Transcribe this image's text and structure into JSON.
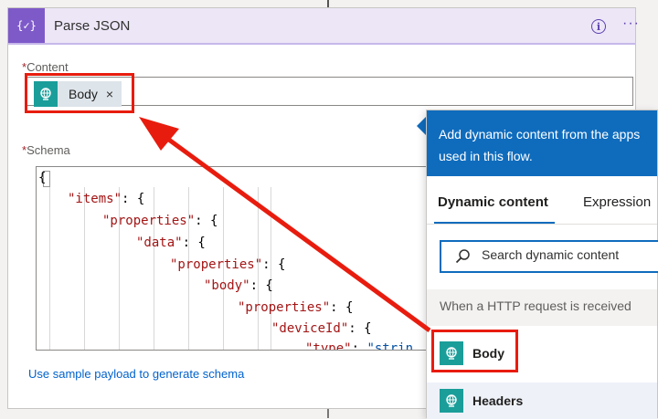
{
  "action": {
    "header_icon": "{✓}",
    "title": "Parse JSON",
    "info_icon": "info-icon",
    "more_icon": "more-options-icon"
  },
  "content_field": {
    "required_mark": "*",
    "label": "Content",
    "token_label": "Body",
    "token_close": "×"
  },
  "schema_field": {
    "required_mark": "*",
    "label": "Schema",
    "lines": [
      {
        "text": "{"
      },
      {
        "key": "\"items\"",
        "rest": ": {"
      },
      {
        "key": "\"properties\"",
        "rest": ": {"
      },
      {
        "key": "\"data\"",
        "rest": ": {"
      },
      {
        "key": "\"properties\"",
        "rest": ": {"
      },
      {
        "key": "\"body\"",
        "rest": ": {"
      },
      {
        "key": "\"properties\"",
        "rest": ": {"
      },
      {
        "key": "\"deviceId\"",
        "rest": ": {"
      },
      {
        "key": "\"type\"",
        "rest": ": ",
        "value": "\"strin"
      }
    ]
  },
  "sample_link": "Use sample payload to generate schema",
  "dynamic_panel": {
    "header_text": "Add dynamic content from the apps used in this flow.",
    "tab_dynamic": "Dynamic content",
    "tab_expression": "Expression",
    "search_placeholder": "Search dynamic content",
    "group_label": "When a HTTP request is received",
    "items": [
      {
        "label": "Body",
        "icon": "http-request-icon"
      },
      {
        "label": "Headers",
        "icon": "http-request-icon"
      }
    ]
  },
  "colors": {
    "accent_purple": "#7e5ac9",
    "token_teal": "#1b9e9a",
    "panel_blue": "#0f6cbd",
    "annotation_red": "#e81c0e"
  }
}
